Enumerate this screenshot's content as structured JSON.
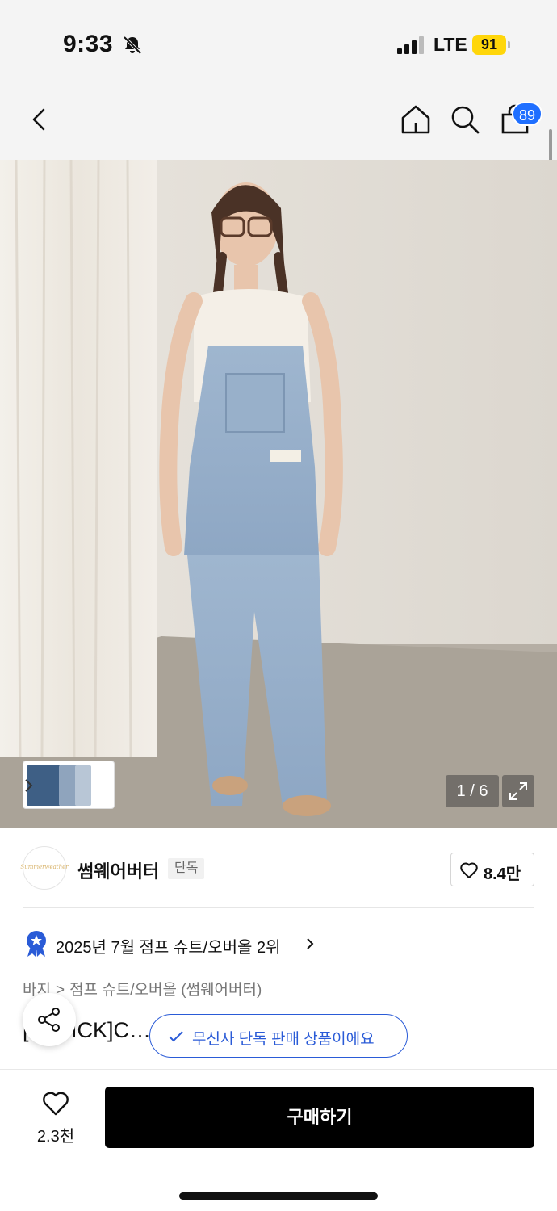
{
  "status_bar": {
    "time": "9:33",
    "network": "LTE",
    "battery": "91"
  },
  "header": {
    "cart_count": "89"
  },
  "gallery": {
    "counter": "1 / 6",
    "thumbnails": [
      "thumb-1",
      "thumb-2",
      "thumb-3"
    ]
  },
  "brand": {
    "logo_text": "Summerweather",
    "name": "썸웨어버터",
    "tag": "단독",
    "likes": "8.4만"
  },
  "ranking": {
    "text": "2025년 7월 점프 슈트/오버올 2위"
  },
  "breadcrumb": {
    "level1": "바지",
    "level2": "점프 슈트/오버올 (썸웨어버터)"
  },
  "product": {
    "title": "[… PICK]C…   Middle Blu e"
  },
  "toast": {
    "text": "무신사 단독 판매 상품이에요"
  },
  "bottom": {
    "wish_count": "2.3천",
    "buy_label": "구매하기"
  },
  "colors": {
    "accent_blue": "#2a5bd7",
    "badge_blue": "#1f6fff",
    "battery_yellow": "#ffd60a"
  }
}
